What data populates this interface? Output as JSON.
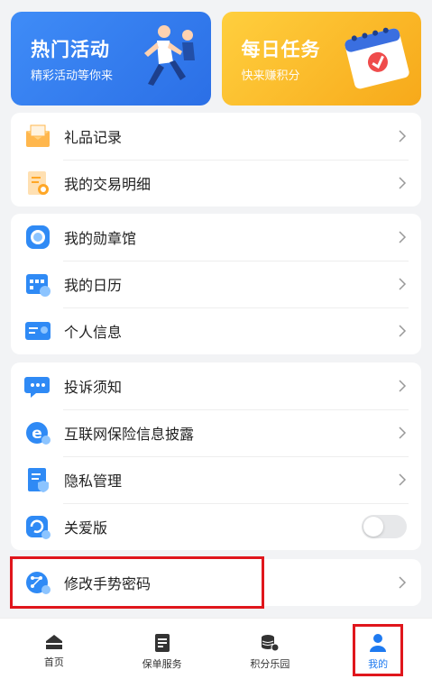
{
  "banners": [
    {
      "title": "热门活动",
      "subtitle": "精彩活动等你来"
    },
    {
      "title": "每日任务",
      "subtitle": "快来赚积分"
    }
  ],
  "group1": [
    {
      "label": "礼品记录",
      "icon": "gift-envelope-icon"
    },
    {
      "label": "我的交易明细",
      "icon": "transaction-document-icon"
    }
  ],
  "group2": [
    {
      "label": "我的勋章馆",
      "icon": "medal-icon"
    },
    {
      "label": "我的日历",
      "icon": "calendar-icon"
    },
    {
      "label": "个人信息",
      "icon": "id-card-icon"
    }
  ],
  "group3": [
    {
      "label": "投诉须知",
      "icon": "chat-bubble-icon"
    },
    {
      "label": "互联网保险信息披露",
      "icon": "internet-e-icon"
    },
    {
      "label": "隐私管理",
      "icon": "privacy-document-icon"
    },
    {
      "label": "关爱版",
      "icon": "care-refresh-icon",
      "toggle": false
    }
  ],
  "group4": [
    {
      "label": "修改手势密码",
      "icon": "gesture-password-icon"
    }
  ],
  "tabs": [
    {
      "label": "首页",
      "icon": "home-icon",
      "active": false
    },
    {
      "label": "保单服务",
      "icon": "policy-document-icon",
      "active": false
    },
    {
      "label": "积分乐园",
      "icon": "coins-stack-icon",
      "active": false
    },
    {
      "label": "我的",
      "icon": "user-icon",
      "active": true
    }
  ],
  "colors": {
    "accent": "#1e7af0",
    "highlight": "#e0161c"
  }
}
